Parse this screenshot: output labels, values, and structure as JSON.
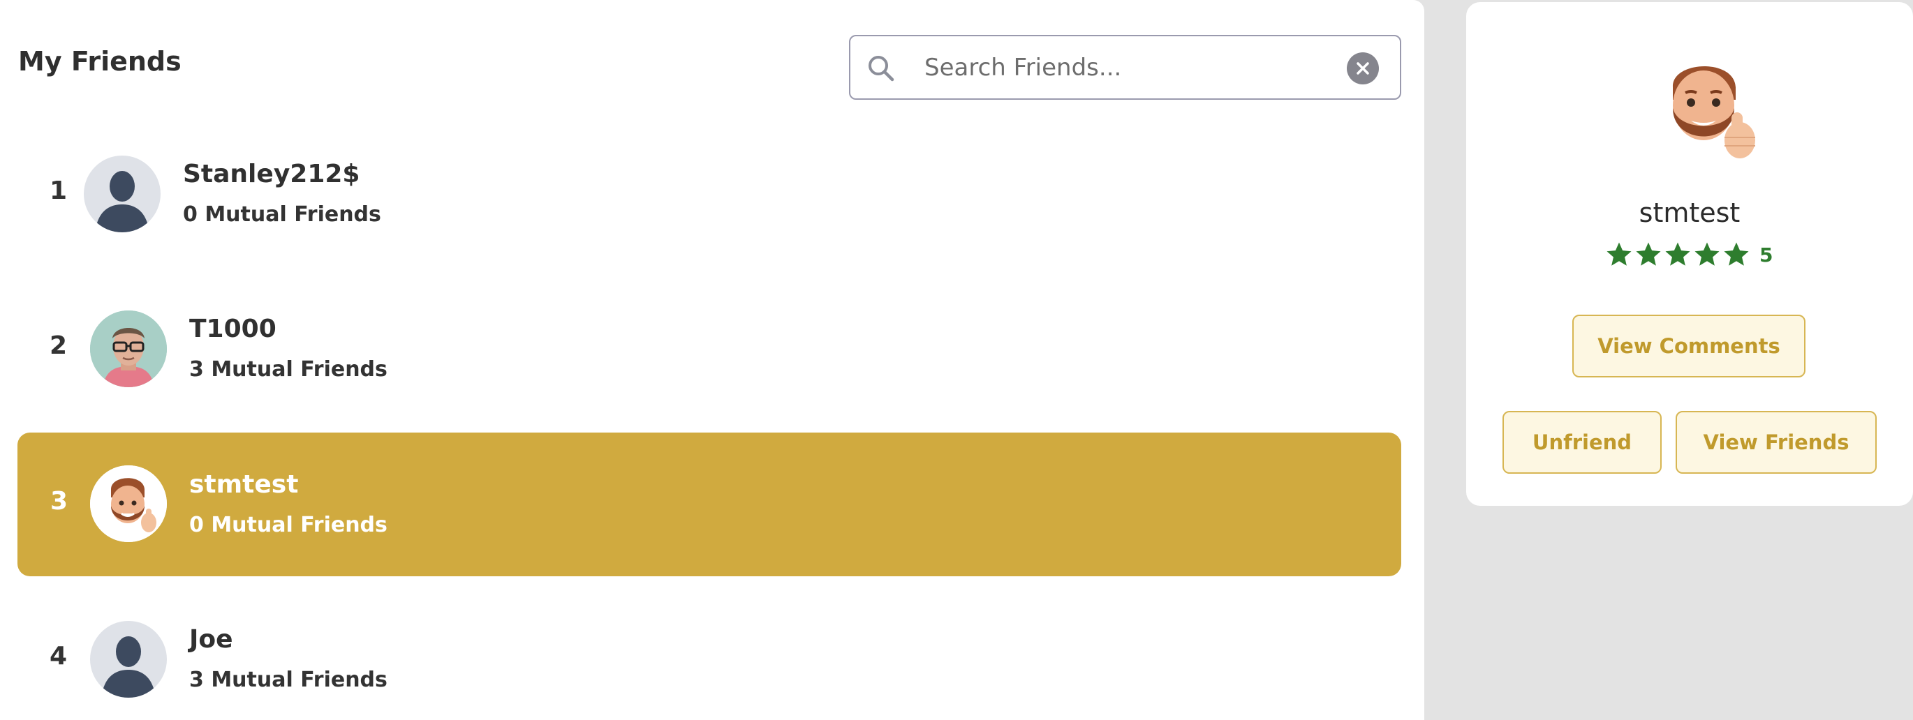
{
  "page_title": "My Friends",
  "search": {
    "placeholder": "Search Friends...",
    "value": ""
  },
  "friends": [
    {
      "rank": "1",
      "name": "Stanley212$",
      "mutual": "0 Mutual Friends",
      "avatar": "default-silhouette"
    },
    {
      "rank": "2",
      "name": "T1000",
      "mutual": "3 Mutual Friends",
      "avatar": "photo-man-glasses"
    },
    {
      "rank": "3",
      "name": "stmtest",
      "mutual": "0 Mutual Friends",
      "avatar": "memoji-thumbs-up",
      "selected": true
    },
    {
      "rank": "4",
      "name": "Joe",
      "mutual": "3 Mutual Friends",
      "avatar": "default-silhouette"
    }
  ],
  "profile": {
    "name": "stmtest",
    "rating": 5,
    "rating_label": "5",
    "buttons": {
      "view_comments": "View Comments",
      "unfriend": "Unfriend",
      "view_friends": "View Friends"
    }
  },
  "colors": {
    "selected_row": "#d0aa3f",
    "star": "#2e7d2e",
    "button_bg": "#fdf7e2",
    "button_text": "#c09a2c"
  }
}
